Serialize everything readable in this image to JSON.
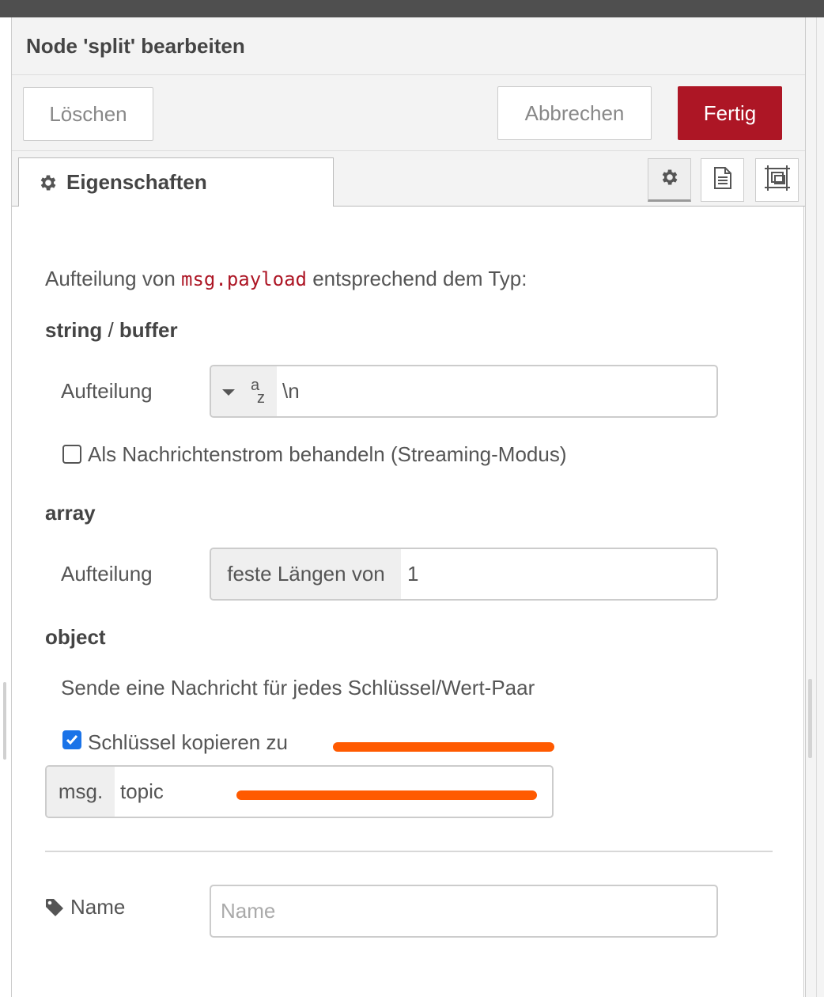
{
  "tray": {
    "title": "Node 'split' bearbeiten"
  },
  "toolbar": {
    "delete_label": "Löschen",
    "cancel_label": "Abbrechen",
    "done_label": "Fertig"
  },
  "tabs": [
    {
      "label": "Eigenschaften",
      "icon": "gear-icon",
      "active": true
    }
  ],
  "tab_icons": [
    "gear-icon",
    "description-icon",
    "appearance-icon"
  ],
  "form": {
    "intro_before": "Aufteilung von",
    "intro_code": "msg.payload",
    "intro_after": "entsprechend dem Typ:",
    "string_section": {
      "title_a": "string",
      "sep": " / ",
      "title_b": "buffer",
      "split_label": "Aufteilung",
      "split_type_icon": "string-type-icon",
      "split_value": "\\n",
      "stream_checked": false,
      "stream_label": "Als Nachrichtenstrom behandeln (Streaming-Modus)"
    },
    "array_section": {
      "title": "array",
      "split_label": "Aufteilung",
      "split_prefix": "feste Längen von",
      "split_value": "1"
    },
    "object_section": {
      "title": "object",
      "description": "Sende eine Nachricht für jedes Schlüssel/Wert-Paar",
      "copy_checked": true,
      "copy_label": "Schlüssel kopieren zu",
      "msg_prefix": "msg.",
      "msg_value": "topic"
    },
    "name_label": "Name",
    "name_placeholder": "Name",
    "name_value": ""
  },
  "colors": {
    "primary_button": "#ad1625",
    "code": "#ad1625",
    "highlight": "#ff5a00",
    "checkbox": "#1a73e8"
  }
}
